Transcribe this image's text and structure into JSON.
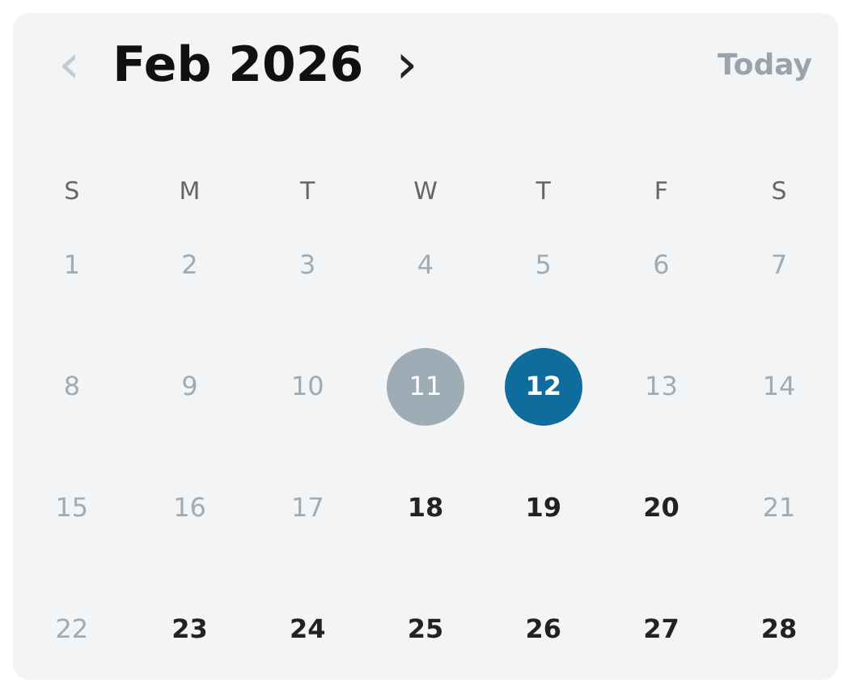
{
  "header": {
    "prev": {
      "label": "‹",
      "disabled": true
    },
    "title": "Feb 2026",
    "next": {
      "label": "›",
      "disabled": false
    },
    "today_button": {
      "label": "Today",
      "disabled": true
    }
  },
  "weekdays": [
    "S",
    "M",
    "T",
    "W",
    "T",
    "F",
    "S"
  ],
  "days": [
    {
      "label": "1",
      "disabled": true,
      "today": false,
      "selected": false
    },
    {
      "label": "2",
      "disabled": true,
      "today": false,
      "selected": false
    },
    {
      "label": "3",
      "disabled": true,
      "today": false,
      "selected": false
    },
    {
      "label": "4",
      "disabled": true,
      "today": false,
      "selected": false
    },
    {
      "label": "5",
      "disabled": true,
      "today": false,
      "selected": false
    },
    {
      "label": "6",
      "disabled": true,
      "today": false,
      "selected": false
    },
    {
      "label": "7",
      "disabled": true,
      "today": false,
      "selected": false
    },
    {
      "label": "8",
      "disabled": true,
      "today": false,
      "selected": false
    },
    {
      "label": "9",
      "disabled": true,
      "today": false,
      "selected": false
    },
    {
      "label": "10",
      "disabled": true,
      "today": false,
      "selected": false
    },
    {
      "label": "11",
      "disabled": true,
      "today": true,
      "selected": false
    },
    {
      "label": "12",
      "disabled": false,
      "today": false,
      "selected": true
    },
    {
      "label": "13",
      "disabled": true,
      "today": false,
      "selected": false
    },
    {
      "label": "14",
      "disabled": true,
      "today": false,
      "selected": false
    },
    {
      "label": "15",
      "disabled": true,
      "today": false,
      "selected": false
    },
    {
      "label": "16",
      "disabled": true,
      "today": false,
      "selected": false
    },
    {
      "label": "17",
      "disabled": true,
      "today": false,
      "selected": false
    },
    {
      "label": "18",
      "disabled": false,
      "today": false,
      "selected": false
    },
    {
      "label": "19",
      "disabled": false,
      "today": false,
      "selected": false
    },
    {
      "label": "20",
      "disabled": false,
      "today": false,
      "selected": false
    },
    {
      "label": "21",
      "disabled": true,
      "today": false,
      "selected": false
    },
    {
      "label": "22",
      "disabled": true,
      "today": false,
      "selected": false
    },
    {
      "label": "23",
      "disabled": false,
      "today": false,
      "selected": false
    },
    {
      "label": "24",
      "disabled": false,
      "today": false,
      "selected": false
    },
    {
      "label": "25",
      "disabled": false,
      "today": false,
      "selected": false
    },
    {
      "label": "26",
      "disabled": false,
      "today": false,
      "selected": false
    },
    {
      "label": "27",
      "disabled": false,
      "today": false,
      "selected": false
    },
    {
      "label": "28",
      "disabled": false,
      "today": false,
      "selected": false
    }
  ]
}
